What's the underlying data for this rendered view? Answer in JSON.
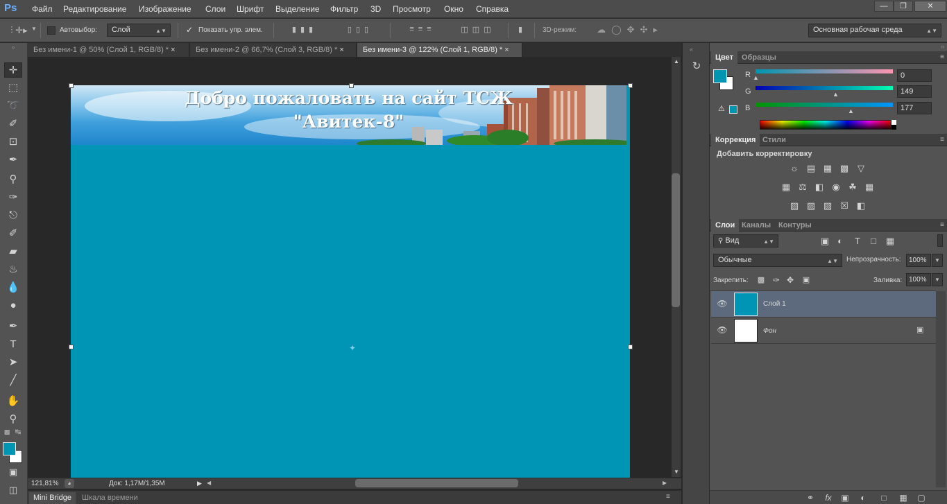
{
  "app": {
    "logo": "Ps",
    "menu": [
      "Файл",
      "Редактирование",
      "Изображение",
      "Слои",
      "Шрифт",
      "Выделение",
      "Фильтр",
      "3D",
      "Просмотр",
      "Окно",
      "Справка"
    ],
    "window_buttons": [
      "minimize-icon",
      "restore-icon",
      "close-icon"
    ]
  },
  "options": {
    "autoselect_label": "Автовыбор:",
    "autoselect_value": "Слой",
    "show_controls_label": "Показать упр. элем.",
    "mode3d_label": "3D-режим:",
    "workspace_value": "Основная рабочая среда"
  },
  "tabs": [
    {
      "label": "Без имени-1 @ 50% (Слой 1, RGB/8) *",
      "active": false
    },
    {
      "label": "Без имени-2 @ 66,7% (Слой 3, RGB/8) *",
      "active": false
    },
    {
      "label": "Без имени-3 @ 122% (Слой 1, RGB/8) *",
      "active": true
    }
  ],
  "document": {
    "banner_line1": "Добро пожаловать на сайт ТСЖ",
    "banner_line2": "\"Авитек-8\"",
    "fill_color": "#0095b4"
  },
  "status": {
    "zoom": "121,81%",
    "doc_info": "Док: 1,17M/1,35M"
  },
  "bottom_tabs": [
    "Mini Bridge",
    "Шкала времени"
  ],
  "color_panel": {
    "tabs": [
      "Цвет",
      "Образцы"
    ],
    "foreground": "#0095b1",
    "background": "#ffffff",
    "r": {
      "label": "R",
      "value": "0"
    },
    "g": {
      "label": "G",
      "value": "149"
    },
    "b": {
      "label": "B",
      "value": "177"
    }
  },
  "adjust_panel": {
    "tabs": [
      "Коррекция",
      "Стили"
    ],
    "title": "Добавить корректировку"
  },
  "layers_panel": {
    "tabs": [
      "Слои",
      "Каналы",
      "Контуры"
    ],
    "filter_kind": "Вид",
    "blend_mode": "Обычные",
    "opacity_label": "Непрозрачность:",
    "opacity_value": "100%",
    "lock_label": "Закрепить:",
    "fill_label": "Заливка:",
    "fill_value": "100%",
    "layers": [
      {
        "name": "Слой 1",
        "selected": true,
        "thumb_color": "#0095b4",
        "locked": false
      },
      {
        "name": "Фон",
        "selected": false,
        "thumb_color": "#ffffff",
        "locked": true
      }
    ]
  }
}
